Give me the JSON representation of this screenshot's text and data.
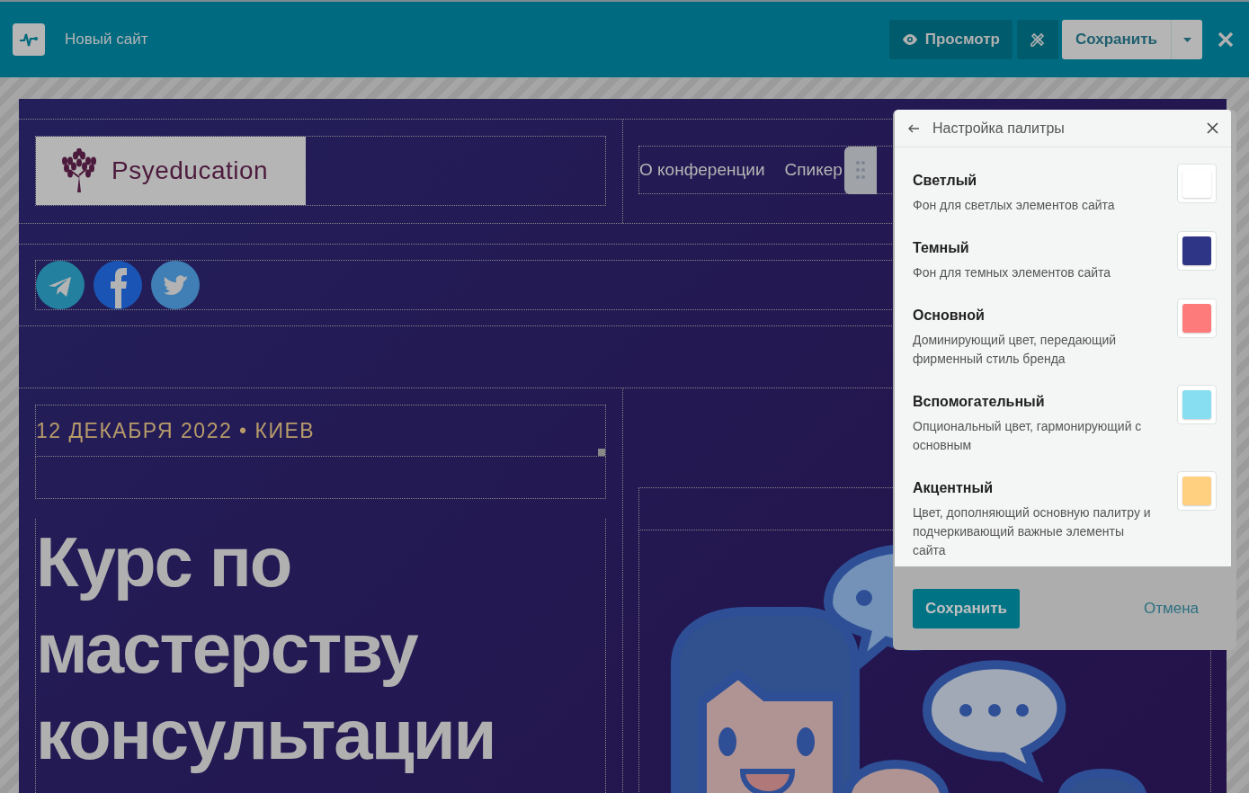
{
  "toolbar": {
    "title": "Новый сайт",
    "preview_button": "Просмотр",
    "save_button": "Сохранить"
  },
  "site": {
    "logo_text": "Psyeducation",
    "nav": [
      "О конференции",
      "Спикер"
    ],
    "event_date": "12 ДЕКАБРЯ 2022 • КИЕВ",
    "heading": "Курс по мастерству консультации"
  },
  "palette_panel": {
    "title": "Настройка палитры",
    "colors": [
      {
        "name": "Светлый",
        "description": "Фон для светлых элементов сайта",
        "color": "#ffffff"
      },
      {
        "name": "Темный",
        "description": "Фон для темных элементов сайта",
        "color": "#2e3586"
      },
      {
        "name": "Основной",
        "description": "Доминирующий цвет, передающий фирменный стиль бренда",
        "color": "#fe7b7b"
      },
      {
        "name": "Вспомогательный",
        "description": "Опциональный цвет, гармонирующий с основным",
        "color": "#86def0"
      },
      {
        "name": "Акцентный",
        "description": "Цвет, дополняющий основную палитру и подчеркивающий важные элементы сайта",
        "color": "#fed080"
      }
    ],
    "save_button": "Сохранить",
    "cancel_button": "Отмена"
  }
}
